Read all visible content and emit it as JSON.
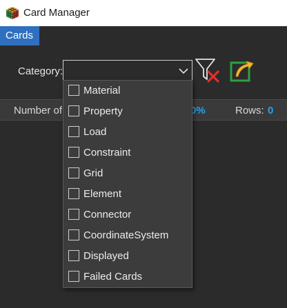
{
  "window": {
    "title": "Card Manager"
  },
  "menu": {
    "items": [
      {
        "label": "Cards"
      }
    ]
  },
  "filter": {
    "category_label": "Category:",
    "category_value": "",
    "options": [
      {
        "label": "Material",
        "checked": false
      },
      {
        "label": "Property",
        "checked": false
      },
      {
        "label": "Load",
        "checked": false
      },
      {
        "label": "Constraint",
        "checked": false
      },
      {
        "label": "Grid",
        "checked": false
      },
      {
        "label": "Element",
        "checked": false
      },
      {
        "label": "Connector",
        "checked": false
      },
      {
        "label": "CoordinateSystem",
        "checked": false
      },
      {
        "label": "Displayed",
        "checked": false
      },
      {
        "label": "Failed Cards",
        "checked": false
      }
    ]
  },
  "toolbar": {
    "clear_filter_icon": "funnel-clear-icon",
    "export_icon": "export-arrow-icon"
  },
  "status": {
    "number_label": "Number of",
    "percent": "0%",
    "rows_label": "Rows:",
    "rows_value": "0"
  },
  "colors": {
    "accent": "#2f6fbf",
    "value_blue": "#1aa6f5",
    "background": "#2b2b2b"
  }
}
